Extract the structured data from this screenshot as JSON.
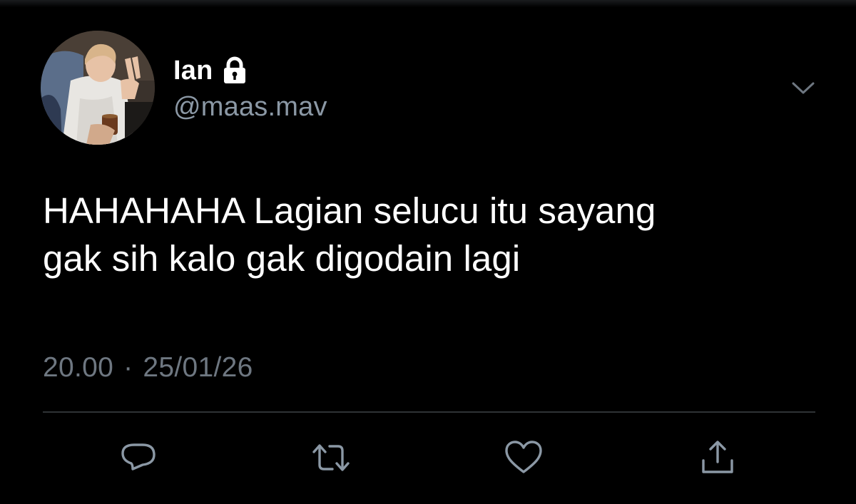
{
  "tweet": {
    "display_name": "Ian",
    "handle": "@maas.mav",
    "text_line1": "HAHAHAHA Lagian selucu itu sayang",
    "text_line2": "gak sih kalo gak digodain lagi",
    "time": "20.00",
    "separator": "·",
    "date": "25/01/26"
  },
  "icons": {
    "lock": "lock-icon",
    "caret": "chevron-down-icon",
    "reply": "reply-icon",
    "retweet": "retweet-icon",
    "like": "heart-icon",
    "share": "share-icon"
  },
  "colors": {
    "background": "#000000",
    "text": "#ffffff",
    "secondary": "#8b98a5",
    "divider": "#2f3336"
  }
}
